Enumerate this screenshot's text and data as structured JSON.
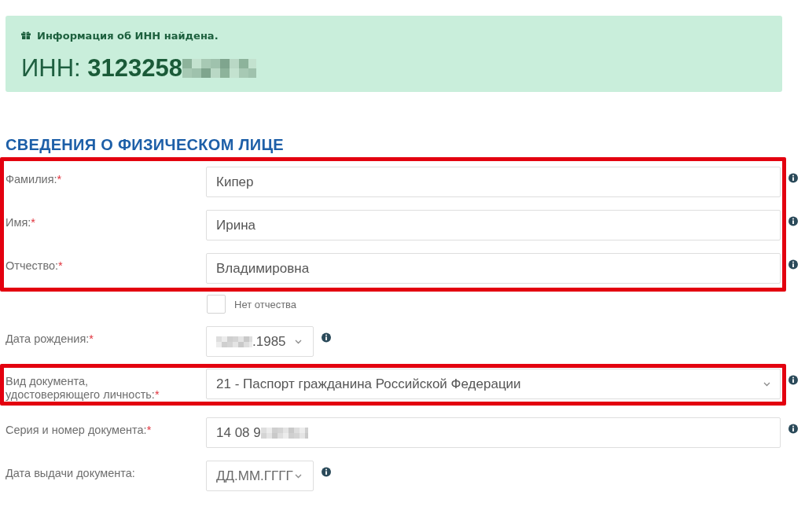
{
  "alert": {
    "message": "Информация об ИНН найдена.",
    "inn_text": "ИНН: **3123258**",
    "inn_redacted": true
  },
  "section_title": "СВЕДЕНИЯ О ФИЗИЧЕСКОМ ЛИЦЕ",
  "field_groups": [
    {
      "highlighted": true,
      "rows": [
        {
          "kind": "text",
          "label": "Фамилия:",
          "required_mark": "*",
          "value": "Кипер",
          "info": true
        },
        {
          "kind": "text",
          "label": "Имя:",
          "required_mark": "*",
          "value": "Ирина",
          "info": true
        },
        {
          "kind": "text",
          "label": "Отчество:",
          "required_mark": "*",
          "value": "Владимировна",
          "info": true
        }
      ]
    },
    {
      "highlighted": false,
      "rows": [
        {
          "kind": "checkbox",
          "label": "Нет отчества",
          "checked": false,
          "info": false
        },
        {
          "kind": "date",
          "label": "Дата рождения:",
          "required_mark": "*",
          "value": ".1985",
          "redacted_prefix": true,
          "info": true
        }
      ]
    },
    {
      "highlighted": true,
      "rows": [
        {
          "kind": "select",
          "label": "Вид документа, удостоверяющего личность:",
          "required_mark": "*",
          "value": "21 - Паспорт гражданина Российской Федерации",
          "info": true
        }
      ]
    },
    {
      "highlighted": false,
      "rows": [
        {
          "kind": "text",
          "label": "Серия и номер документа:",
          "required_mark": "*",
          "value": "14 08 9",
          "redacted_suffix": true,
          "info": true
        },
        {
          "kind": "date",
          "label": "Дата выдачи документа:",
          "placeholder": "ДД.ММ.ГГГГ",
          "info": true
        }
      ]
    }
  ]
}
